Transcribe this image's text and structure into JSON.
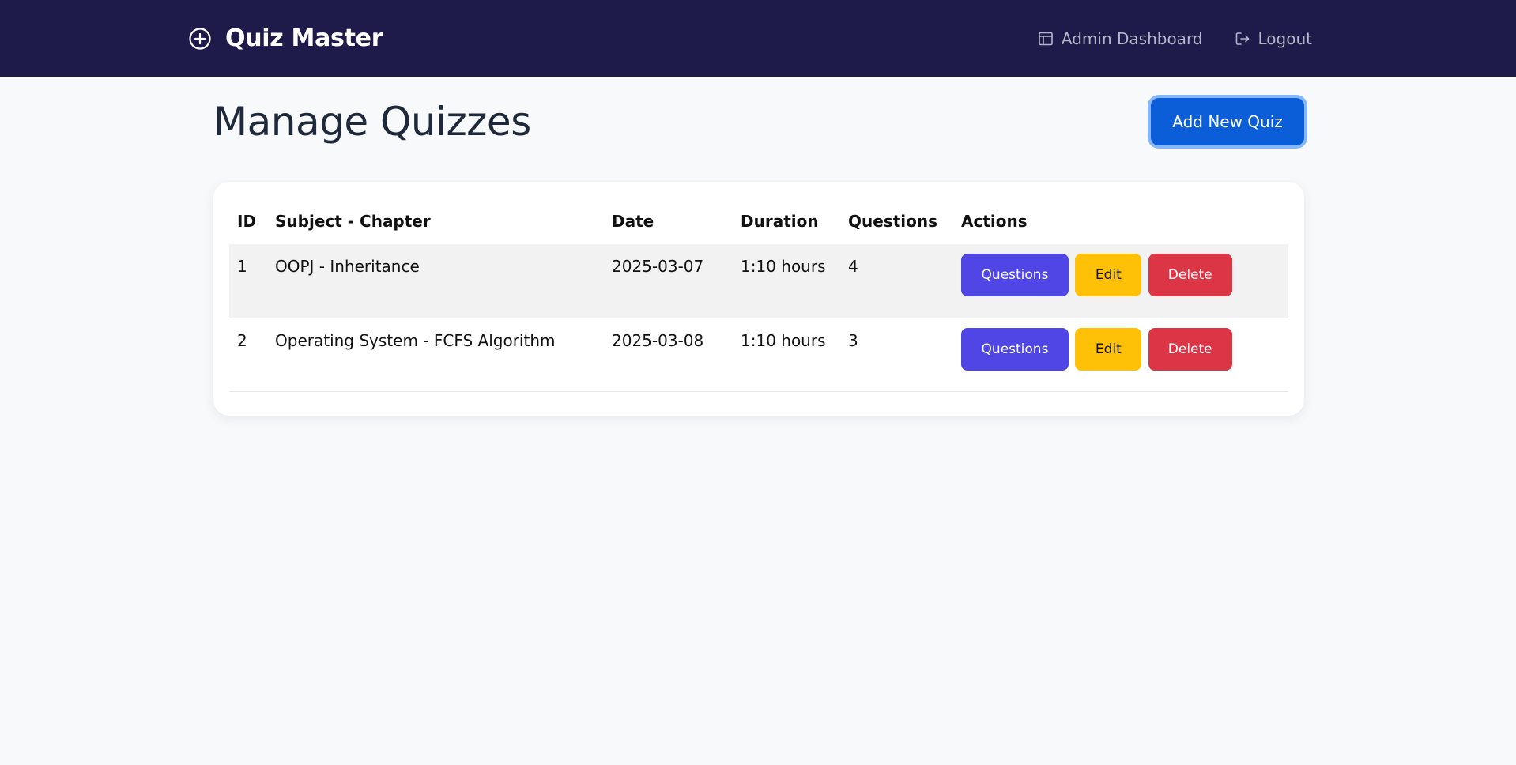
{
  "navbar": {
    "brand": "Quiz Master",
    "links": [
      {
        "label": "Admin Dashboard",
        "icon": "layout-icon"
      },
      {
        "label": "Logout",
        "icon": "logout-icon"
      }
    ]
  },
  "page": {
    "title": "Manage Quizzes",
    "add_button": "Add New Quiz"
  },
  "table": {
    "columns": [
      "ID",
      "Subject - Chapter",
      "Date",
      "Duration",
      "Questions",
      "Actions"
    ],
    "rows": [
      {
        "id": "1",
        "subject_chapter": "OOPJ - Inheritance",
        "date": "2025-03-07",
        "duration": "1:10 hours",
        "questions": "4"
      },
      {
        "id": "2",
        "subject_chapter": "Operating System - FCFS Algorithm",
        "date": "2025-03-08",
        "duration": "1:10 hours",
        "questions": "3"
      }
    ],
    "actions": {
      "questions": "Questions",
      "edit": "Edit",
      "delete": "Delete"
    }
  },
  "colors": {
    "navbar_bg": "#1e1b4b",
    "primary": "#0b5ed7",
    "questions_btn": "#4f46e5",
    "edit_btn": "#ffc107",
    "delete_btn": "#dc3545"
  }
}
